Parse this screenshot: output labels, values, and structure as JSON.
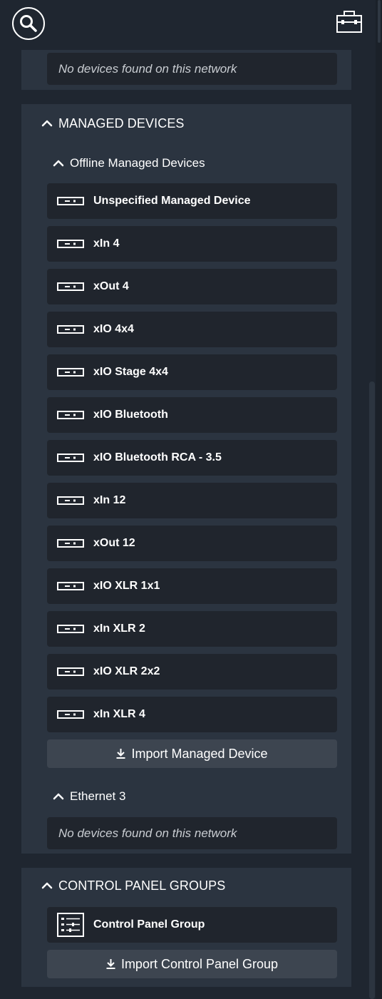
{
  "top_bar": {
    "search_icon": "search-icon",
    "toolbox_icon": "toolbox-icon"
  },
  "top_section": {
    "empty_message": "No devices found on this network"
  },
  "managed_devices": {
    "header": "MANAGED DEVICES",
    "offline_group": {
      "header": "Offline Managed Devices",
      "devices": [
        {
          "label": "Unspecified Managed Device"
        },
        {
          "label": "xIn 4"
        },
        {
          "label": "xOut 4"
        },
        {
          "label": "xIO 4x4"
        },
        {
          "label": "xIO Stage 4x4"
        },
        {
          "label": "xIO Bluetooth"
        },
        {
          "label": "xIO Bluetooth RCA - 3.5"
        },
        {
          "label": "xIn 12"
        },
        {
          "label": "xOut 12"
        },
        {
          "label": "xIO XLR 1x1"
        },
        {
          "label": "xIn XLR 2"
        },
        {
          "label": "xIO XLR 2x2"
        },
        {
          "label": "xIn XLR 4"
        }
      ],
      "import_button": "Import Managed Device"
    },
    "ethernet_group": {
      "header": "Ethernet 3",
      "empty_message": "No devices found on this network"
    }
  },
  "control_panel_groups": {
    "header": "CONTROL PANEL GROUPS",
    "items": [
      {
        "label": "Control Panel Group"
      }
    ],
    "import_button": "Import Control Panel Group"
  },
  "colors": {
    "background": "#1f2630",
    "panel": "#2b3440",
    "row": "#20252d",
    "button": "#3d4550",
    "text": "#ffffff",
    "muted_text": "#c9cdd2"
  }
}
